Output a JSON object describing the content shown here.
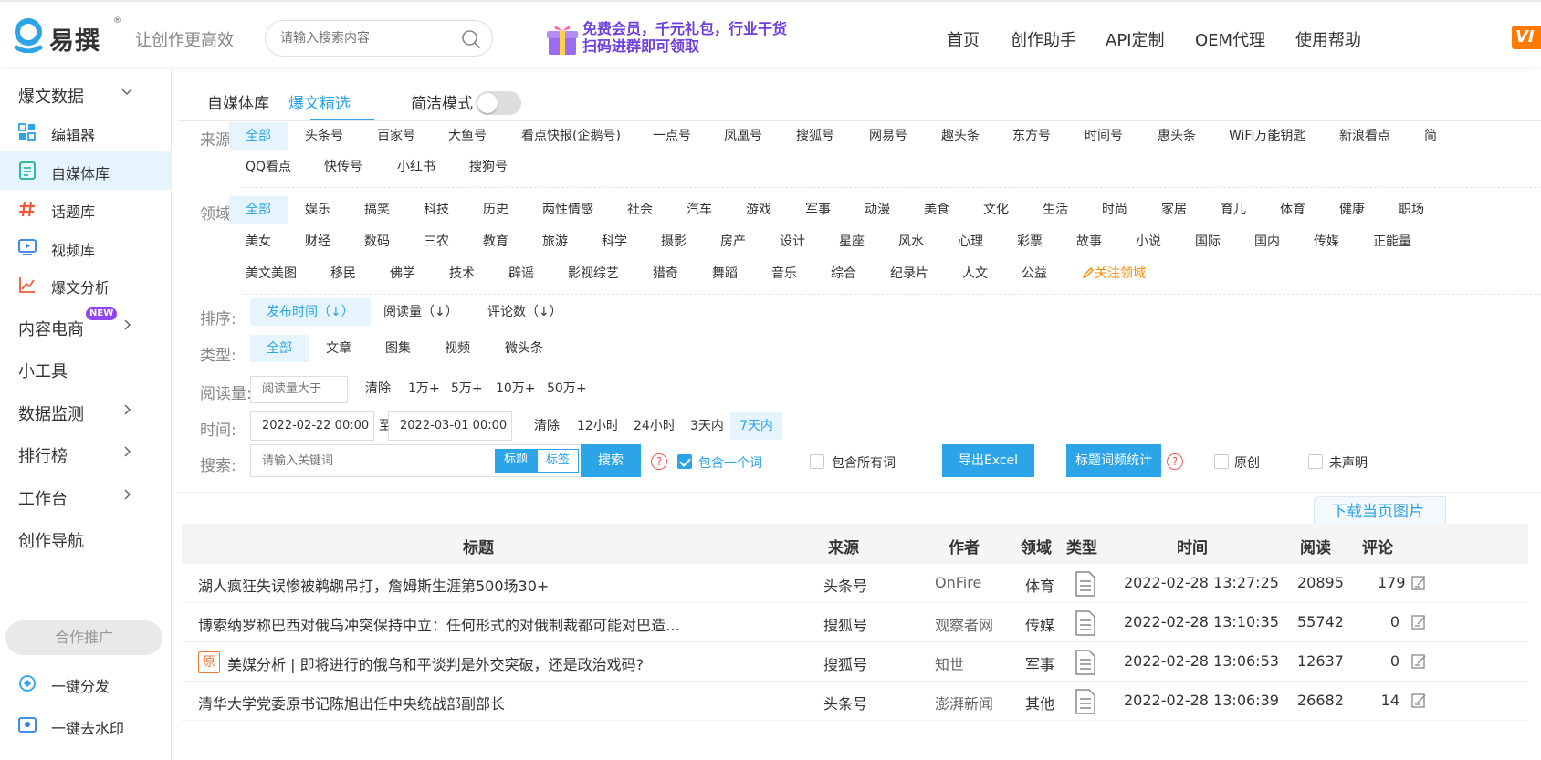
{
  "header": {
    "logo_text": "易撰",
    "logo_reg": "®",
    "slogan": "让创作更高效",
    "search_placeholder": "请输入搜索内容",
    "promo_line1": "免费会员，千元礼包，行业干货",
    "promo_line2": "扫码进群即可领取",
    "nav": [
      "首页",
      "创作助手",
      "API定制",
      "OEM代理",
      "使用帮助"
    ],
    "vip_label": "VI"
  },
  "sidebar": {
    "group_top": "爆文数据",
    "items": [
      {
        "label": "编辑器",
        "icon": "grid-icon"
      },
      {
        "label": "自媒体库",
        "icon": "document-icon",
        "active": true
      },
      {
        "label": "话题库",
        "icon": "hash-icon"
      },
      {
        "label": "视频库",
        "icon": "video-icon"
      },
      {
        "label": "爆文分析",
        "icon": "chart-icon"
      }
    ],
    "groups": [
      "内容电商",
      "小工具",
      "数据监测",
      "排行榜",
      "工作台",
      "创作导航"
    ],
    "new_badge": "NEW",
    "coop_label": "合作推广",
    "tools": [
      "一键分发",
      "一键去水印"
    ]
  },
  "tabs": {
    "items": [
      "自媒体库",
      "爆文精选"
    ],
    "active": 1,
    "simple_mode": "简洁模式"
  },
  "filters": {
    "source_label": "来源:",
    "sources_row1": [
      "全部",
      "头条号",
      "百家号",
      "大鱼号",
      "看点快报(企鹅号)",
      "一点号",
      "凤凰号",
      "搜狐号",
      "网易号",
      "趣头条",
      "东方号",
      "时间号",
      "惠头条",
      "WiFi万能钥匙",
      "新浪看点",
      "简"
    ],
    "sources_row2": [
      "QQ看点",
      "快传号",
      "小红书",
      "搜狗号"
    ],
    "domain_label": "领域:",
    "domains_row1": [
      "全部",
      "娱乐",
      "搞笑",
      "科技",
      "历史",
      "两性情感",
      "社会",
      "汽车",
      "游戏",
      "军事",
      "动漫",
      "美食",
      "文化",
      "生活",
      "时尚",
      "家居",
      "育儿",
      "体育",
      "健康",
      "职场"
    ],
    "domains_row2": [
      "美女",
      "财经",
      "数码",
      "三农",
      "教育",
      "旅游",
      "科学",
      "摄影",
      "房产",
      "设计",
      "星座",
      "风水",
      "心理",
      "彩票",
      "故事",
      "小说",
      "国际",
      "国内",
      "传媒",
      "正能量"
    ],
    "domains_row3": [
      "美文美图",
      "移民",
      "佛学",
      "技术",
      "辟谣",
      "影视综艺",
      "猎奇",
      "舞蹈",
      "音乐",
      "综合",
      "纪录片",
      "人文",
      "公益"
    ],
    "follow_label": "关注领域",
    "sort_label": "排序:",
    "sorts": [
      "发布时间（↓）",
      "阅读量（↓）",
      "评论数（↓）"
    ],
    "type_label": "类型:",
    "types": [
      "全部",
      "文章",
      "图集",
      "视频",
      "微头条"
    ],
    "reads_label": "阅读量:",
    "reads_placeholder": "阅读量大于",
    "reads_options": [
      "清除",
      "1万+",
      "5万+",
      "10万+",
      "50万+"
    ],
    "time_label": "时间:",
    "time_from": "2022-02-22 00:00",
    "time_to_sep": "至",
    "time_to": "2022-03-01 00:00",
    "time_options": [
      "清除",
      "12小时",
      "24小时",
      "3天内",
      "7天内"
    ],
    "search_label": "搜索:",
    "search_placeholder": "请输入关键词",
    "seg_title": "标题",
    "seg_tag": "标签",
    "search_btn": "搜索",
    "help": "?",
    "contains_one": "包含一个词",
    "contains_all": "包含所有词",
    "export_btn": "导出Excel",
    "word_freq_btn": "标题词频统计",
    "original": "原创",
    "undeclared": "未声明"
  },
  "download_label": "下载当页图片",
  "table": {
    "headers": [
      "标题",
      "来源",
      "作者",
      "领域",
      "类型",
      "时间",
      "阅读",
      "评论"
    ],
    "orig_mark": "原",
    "rows": [
      {
        "title": "湖人疯狂失误惨被鹈鹕吊打，詹姆斯生涯第500场30+",
        "source": "头条号",
        "author": "OnFire",
        "domain": "体育",
        "time": "2022-02-28 13:27:25",
        "reads": "20895",
        "comments": "179",
        "original": false
      },
      {
        "title": "博索纳罗称巴西对俄乌冲突保持中立：任何形式的对俄制裁都可能对巴造…",
        "source": "搜狐号",
        "author": "观察者网",
        "domain": "传媒",
        "time": "2022-02-28 13:10:35",
        "reads": "55742",
        "comments": "0",
        "original": false
      },
      {
        "title": "美媒分析 | 即将进行的俄乌和平谈判是外交突破，还是政治戏码?",
        "source": "搜狐号",
        "author": "知世",
        "domain": "军事",
        "time": "2022-02-28 13:06:53",
        "reads": "12637",
        "comments": "0",
        "original": true
      },
      {
        "title": "清华大学党委原书记陈旭出任中央统战部副部长",
        "source": "头条号",
        "author": "澎湃新闻",
        "domain": "其他",
        "time": "2022-02-28 13:06:39",
        "reads": "26682",
        "comments": "14",
        "original": false
      }
    ]
  },
  "colors": {
    "accent": "#2ba4e8",
    "orange": "#ff8a00",
    "badge": "#8e44f0"
  }
}
